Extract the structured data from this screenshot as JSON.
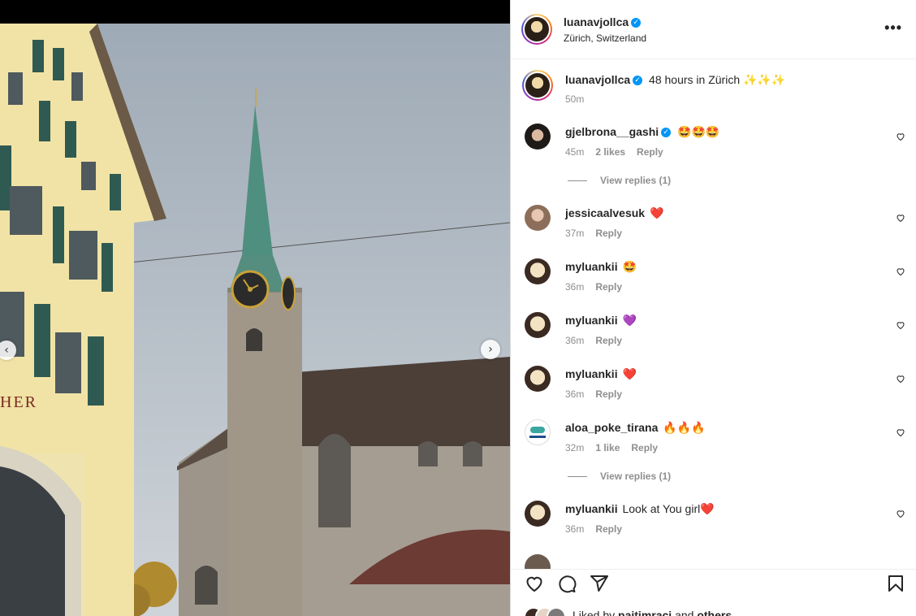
{
  "post": {
    "author": "luanavjollca",
    "location": "Zürich, Switzerland",
    "caption": "48 hours in Zürich ✨✨✨",
    "caption_time": "50m",
    "more": "•••",
    "signage_text": "HER"
  },
  "comments": [
    {
      "user": "gjelbrona__gashi",
      "verified": true,
      "text": "🤩🤩🤩",
      "time": "45m",
      "likes": "2 likes",
      "reply": "Reply",
      "view_replies": "View replies (1)"
    },
    {
      "user": "jessicaalvesuk",
      "verified": false,
      "text": "❤️",
      "time": "37m",
      "likes": "",
      "reply": "Reply",
      "view_replies": ""
    },
    {
      "user": "myluankii",
      "verified": false,
      "text": "🤩",
      "time": "36m",
      "likes": "",
      "reply": "Reply",
      "view_replies": ""
    },
    {
      "user": "myluankii",
      "verified": false,
      "text": "💜",
      "time": "36m",
      "likes": "",
      "reply": "Reply",
      "view_replies": ""
    },
    {
      "user": "myluankii",
      "verified": false,
      "text": "❤️",
      "time": "36m",
      "likes": "",
      "reply": "Reply",
      "view_replies": ""
    },
    {
      "user": "aloa_poke_tirana",
      "verified": false,
      "text": "🔥🔥🔥",
      "time": "32m",
      "likes": "1 like",
      "reply": "Reply",
      "view_replies": "View replies (1)"
    },
    {
      "user": "myluankii",
      "verified": false,
      "text": "Look at You girl❤️",
      "time": "36m",
      "likes": "",
      "reply": "Reply",
      "view_replies": ""
    }
  ],
  "footer": {
    "liked_prefix": "Liked by ",
    "liked_user": "paitimraci",
    "liked_mid": " and ",
    "liked_others": "others"
  },
  "icons": {
    "like": "heart-icon",
    "comment": "comment-icon",
    "share": "send-icon",
    "save": "bookmark-icon",
    "prev": "chevron-left-icon",
    "next": "chevron-right-icon"
  },
  "colors": {
    "verified": "#0095f6",
    "muted": "#8e8e8e",
    "text": "#262626"
  }
}
